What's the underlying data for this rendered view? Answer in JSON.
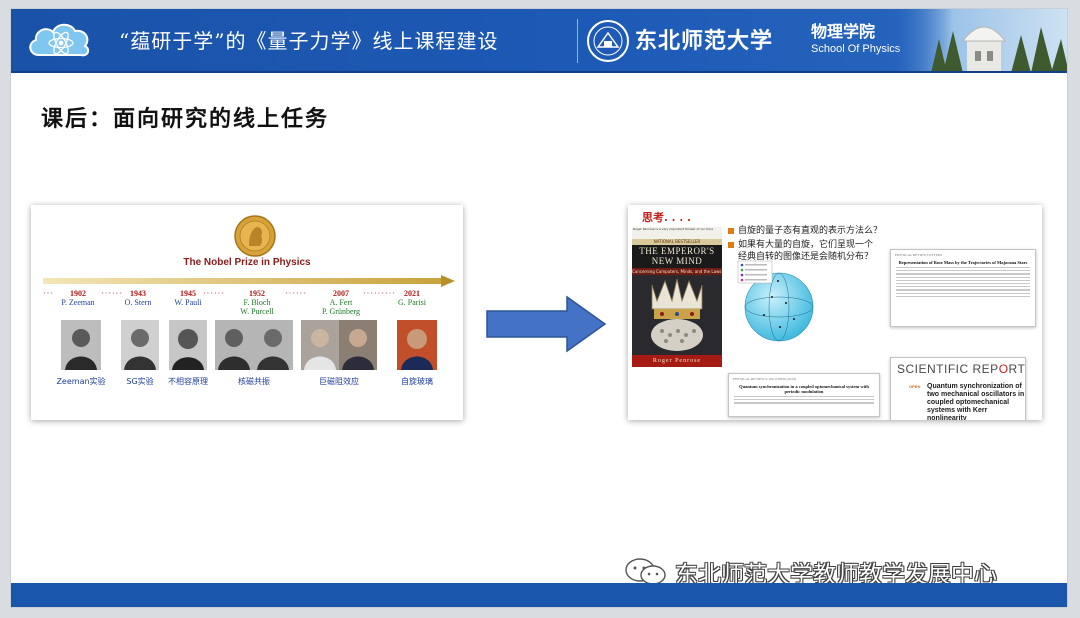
{
  "header": {
    "title": "“蕴研于学”的《量子力学》线上课程建设",
    "university": "东北师范大学",
    "school_cn": "物理学院",
    "school_en": "School Of Physics"
  },
  "section_title": "课后：面向研究的线上任务",
  "nobel": {
    "title": "The Nobel Prize in Physics",
    "entries": [
      {
        "year": "1902",
        "names": [
          "P. Zeeman"
        ],
        "caption": "Zeeman实验"
      },
      {
        "year": "1943",
        "names": [
          "O. Stern"
        ],
        "caption": "SG实验"
      },
      {
        "year": "1945",
        "names": [
          "W. Pauli"
        ],
        "caption": "不相容原理"
      },
      {
        "year": "1952",
        "names": [
          "F. Bloch",
          "W. Purcell"
        ],
        "caption": "核磁共振"
      },
      {
        "year": "2007",
        "names": [
          "A. Fert",
          "P. Grünberg"
        ],
        "caption": "巨磁阻效应"
      },
      {
        "year": "2021",
        "names": [
          "G. Parisi"
        ],
        "caption": "自旋玻璃"
      }
    ]
  },
  "thinking": {
    "label": "思考. . . .",
    "questions": [
      "自旋的量子态有直观的表示方法么？",
      "如果有大量的自旋，它们呈现一个",
      "经典自转的图像还是会随机分布？"
    ]
  },
  "book": {
    "top_text": "Roger Penrose is a very important thinker of our time",
    "bestseller": "NATIONAL BESTSELLER",
    "title_line1": "THE EMPEROR'S",
    "title_line2": "NEW MIND",
    "subtitle": "Concerning Computers, Minds, and the Laws of Physics",
    "author": "Roger Penrose"
  },
  "papers": {
    "prl_header": "PHYSICAL REVIEW LETTERS",
    "prl_title": "Representation of Bose Mass by the Trajectories of Majorana Stars",
    "pra_header": "PHYSICAL REVIEW A 100, 033830 (2019)",
    "pra_title": "Quantum synchronization in a coupled optomechanical system with periodic modulation",
    "sr_logo_a": "SCIENTIFIC REP",
    "sr_logo_b": "O",
    "sr_logo_c": "RTS",
    "sr_open": "OPEN",
    "sr_title": "Quantum synchronization of two mechanical oscillators in coupled optomechanical systems with Kerr nonlinearity"
  },
  "watermark": "东北师范大学教师教学发展中心",
  "colors": {
    "header_blue": "#1d5ab6",
    "footer_blue": "#1a56ac",
    "year_red": "#b21a1a",
    "arrow_blue": "#4472c4",
    "bullet_orange": "#e07a12"
  }
}
